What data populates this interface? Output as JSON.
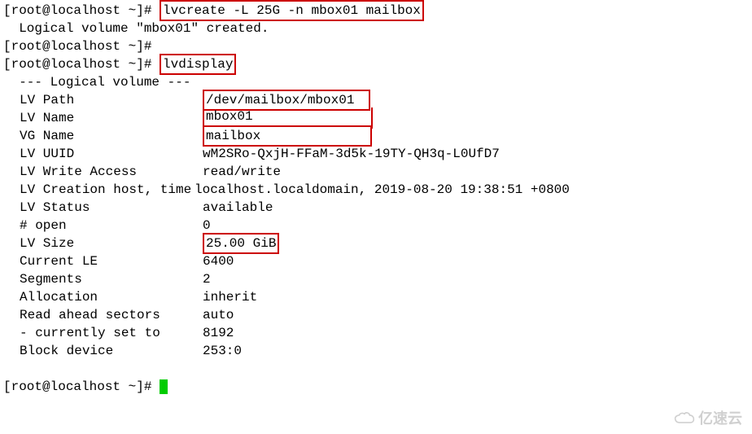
{
  "prompt1": "[root@localhost ~]# ",
  "cmd1": "lvcreate -L 25G -n mbox01 mailbox",
  "output1": "  Logical volume \"mbox01\" created.",
  "prompt2": "[root@localhost ~]#",
  "prompt3": "[root@localhost ~]# ",
  "cmd2": "lvdisplay",
  "header": "  --- Logical volume ---",
  "fields": {
    "lv_path": {
      "label": "LV Path",
      "value": "/dev/mailbox/mbox01"
    },
    "lv_name": {
      "label": "LV Name",
      "value": "mbox01"
    },
    "vg_name": {
      "label": "VG Name",
      "value": "mailbox"
    },
    "lv_uuid": {
      "label": "LV UUID",
      "value": "wM2SRo-QxjH-FFaM-3d5k-19TY-QH3q-L0UfD7"
    },
    "lv_write_access": {
      "label": "LV Write Access",
      "value": "read/write"
    },
    "lv_creation": {
      "label": "LV Creation host, time",
      "value": " localhost.localdomain, 2019-08-20 19:38:51 +0800"
    },
    "lv_status": {
      "label": "LV Status",
      "value": "available"
    },
    "open": {
      "label": "# open",
      "value": "0"
    },
    "lv_size": {
      "label": "LV Size",
      "value": "25.00 GiB"
    },
    "current_le": {
      "label": "Current LE",
      "value": "6400"
    },
    "segments": {
      "label": "Segments",
      "value": "2"
    },
    "allocation": {
      "label": "Allocation",
      "value": "inherit"
    },
    "read_ahead": {
      "label": "Read ahead sectors",
      "value": "auto"
    },
    "currently_set": {
      "label": "- currently set to",
      "value": "8192"
    },
    "block_device": {
      "label": "Block device",
      "value": "253:0"
    }
  },
  "prompt4": "[root@localhost ~]# ",
  "watermark": "亿速云"
}
